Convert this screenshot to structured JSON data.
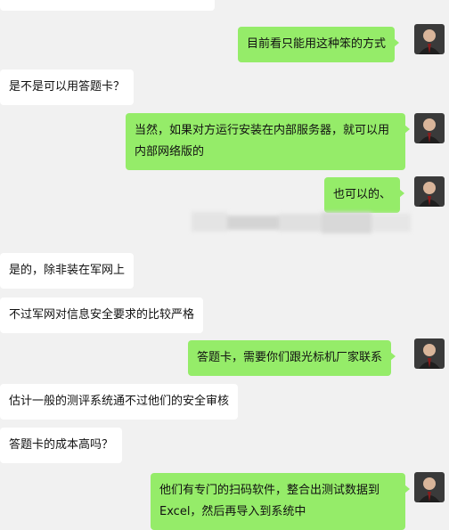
{
  "conversation": {
    "messages": [
      {
        "side": "right",
        "text": "目前看只能用这种笨的方式"
      },
      {
        "side": "left",
        "text": "是不是可以用答题卡？"
      },
      {
        "side": "right",
        "text": "当然，如果对方运行安装在内部服务器，就可以用内部网络版的"
      },
      {
        "side": "right",
        "text": "也可以的、"
      },
      {
        "side": "left",
        "text": "是的，除非装在军网上"
      },
      {
        "side": "left",
        "text": "不过军网对信息安全要求的比较严格"
      },
      {
        "side": "right",
        "text": "答题卡，需要你们跟光标机厂家联系"
      },
      {
        "side": "left",
        "text": "估计一般的测评系统通不过他们的安全审核"
      },
      {
        "side": "left",
        "text": "答题卡的成本高吗？"
      },
      {
        "side": "right",
        "text": "他们有专门的扫码软件，整合出测试数据到Excel，然后再导入到系统中"
      }
    ]
  },
  "colors": {
    "background": "#f1f1f1",
    "incoming_bubble": "#ffffff",
    "outgoing_bubble": "#95ec69"
  },
  "icons": {
    "self_avatar": "user-avatar-icon",
    "redacted": "blurred-message"
  }
}
